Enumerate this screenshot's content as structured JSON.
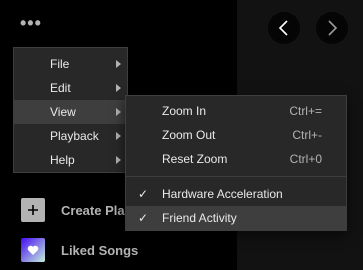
{
  "menubar": {
    "ellipsis_label": "•••"
  },
  "nav": {
    "back_icon": "chevron-left-icon",
    "forward_icon": "chevron-right-icon"
  },
  "sidebar": {
    "items": [
      {
        "label": "Create Playlist",
        "icon": "plus-icon"
      },
      {
        "label": "Liked Songs",
        "icon": "heart-icon"
      }
    ]
  },
  "main_menu": {
    "items": [
      {
        "label": "File",
        "has_submenu": true
      },
      {
        "label": "Edit",
        "has_submenu": true
      },
      {
        "label": "View",
        "has_submenu": true,
        "active": true
      },
      {
        "label": "Playback",
        "has_submenu": true
      },
      {
        "label": "Help",
        "has_submenu": true
      }
    ]
  },
  "view_submenu": {
    "items": [
      {
        "label": "Zoom In",
        "shortcut": "Ctrl+="
      },
      {
        "label": "Zoom Out",
        "shortcut": "Ctrl+-"
      },
      {
        "label": "Reset Zoom",
        "shortcut": "Ctrl+0"
      }
    ],
    "toggles": [
      {
        "label": "Hardware Acceleration",
        "checked": true,
        "check": "✓"
      },
      {
        "label": "Friend Activity",
        "checked": true,
        "check": "✓",
        "active": true
      }
    ]
  },
  "colors": {
    "background": "#000000",
    "main_pane": "#121212",
    "menu_bg": "#282828",
    "menu_highlight": "#3e3e3e",
    "text": "#eaeaea",
    "muted_text": "#b3b3b3"
  }
}
